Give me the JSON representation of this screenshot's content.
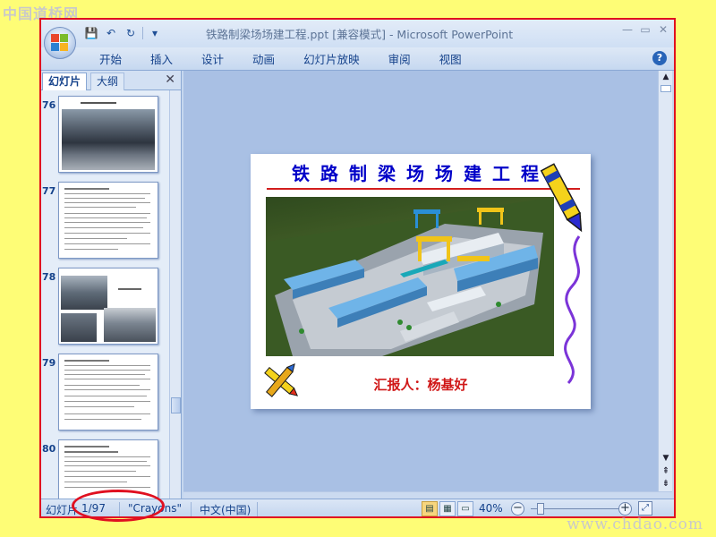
{
  "watermark": {
    "top": "中国道桥网",
    "bottom": "www.chdao.com"
  },
  "window": {
    "title": "铁路制梁场场建工程.ppt [兼容模式] - Microsoft PowerPoint",
    "controls": [
      "—",
      "▭",
      "✕"
    ]
  },
  "qat": {
    "save": "💾",
    "undo": "↶",
    "redo": "↻",
    "customize": "▾"
  },
  "ribbon": {
    "tabs": [
      "开始",
      "插入",
      "设计",
      "动画",
      "幻灯片放映",
      "审阅",
      "视图"
    ],
    "help": "?"
  },
  "left_panel": {
    "tabs": {
      "slides": "幻灯片",
      "outline": "大纲"
    },
    "close": "✕",
    "thumbnails": [
      {
        "number": "76",
        "kind": "photo"
      },
      {
        "number": "77",
        "kind": "text"
      },
      {
        "number": "78",
        "kind": "photo2"
      },
      {
        "number": "79",
        "kind": "text"
      },
      {
        "number": "80",
        "kind": "text"
      }
    ]
  },
  "slide": {
    "title": "铁路制梁场场建工程",
    "reporter": "汇报人：杨基好"
  },
  "statusbar": {
    "slide_label": "幻灯片",
    "slide_position": "1/97",
    "theme": "\"Crayons\"",
    "language": "中文(中国)",
    "zoom": "40%",
    "zoom_minus": "−",
    "zoom_plus": "+"
  },
  "colors": {
    "background": "#fefd76",
    "annotation_red": "#e01020",
    "slide_title": "#0000c8",
    "reporter": "#d01818"
  }
}
